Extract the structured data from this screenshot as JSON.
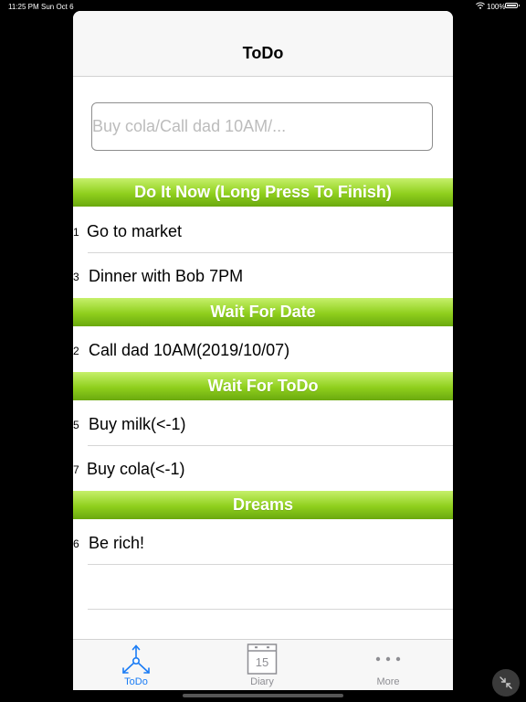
{
  "status": {
    "time": "11:25 PM",
    "date": "Sun Oct 6",
    "battery": "100%"
  },
  "nav": {
    "title": "ToDo"
  },
  "input": {
    "placeholder": "Buy cola/Call dad 10AM/..."
  },
  "sections": [
    {
      "title": "Do It Now (Long Press To Finish)",
      "items": [
        {
          "num": "1",
          "text": "Go to market"
        },
        {
          "num": "3",
          "text": "Dinner with Bob 7PM"
        }
      ]
    },
    {
      "title": "Wait For Date",
      "items": [
        {
          "num": "2",
          "text": "Call dad 10AM(2019/10/07)"
        }
      ]
    },
    {
      "title": "Wait For ToDo",
      "items": [
        {
          "num": "5",
          "text": "Buy milk(<-1)"
        },
        {
          "num": "7",
          "text": "Buy cola(<-1)"
        }
      ]
    },
    {
      "title": "Dreams",
      "items": [
        {
          "num": "6",
          "text": "Be rich!"
        }
      ]
    }
  ],
  "tabs": [
    {
      "label": "ToDo",
      "icon": "todo-network-icon",
      "active": true
    },
    {
      "label": "Diary",
      "icon": "calendar-icon",
      "day": "15",
      "active": false
    },
    {
      "label": "More",
      "icon": "more-dots-icon",
      "active": false
    }
  ],
  "colors": {
    "active_tab": "#1a7cf5",
    "inactive_tab": "#8e8e93",
    "section_green_top": "#c6f06b",
    "section_green_bottom": "#6aa90e"
  }
}
